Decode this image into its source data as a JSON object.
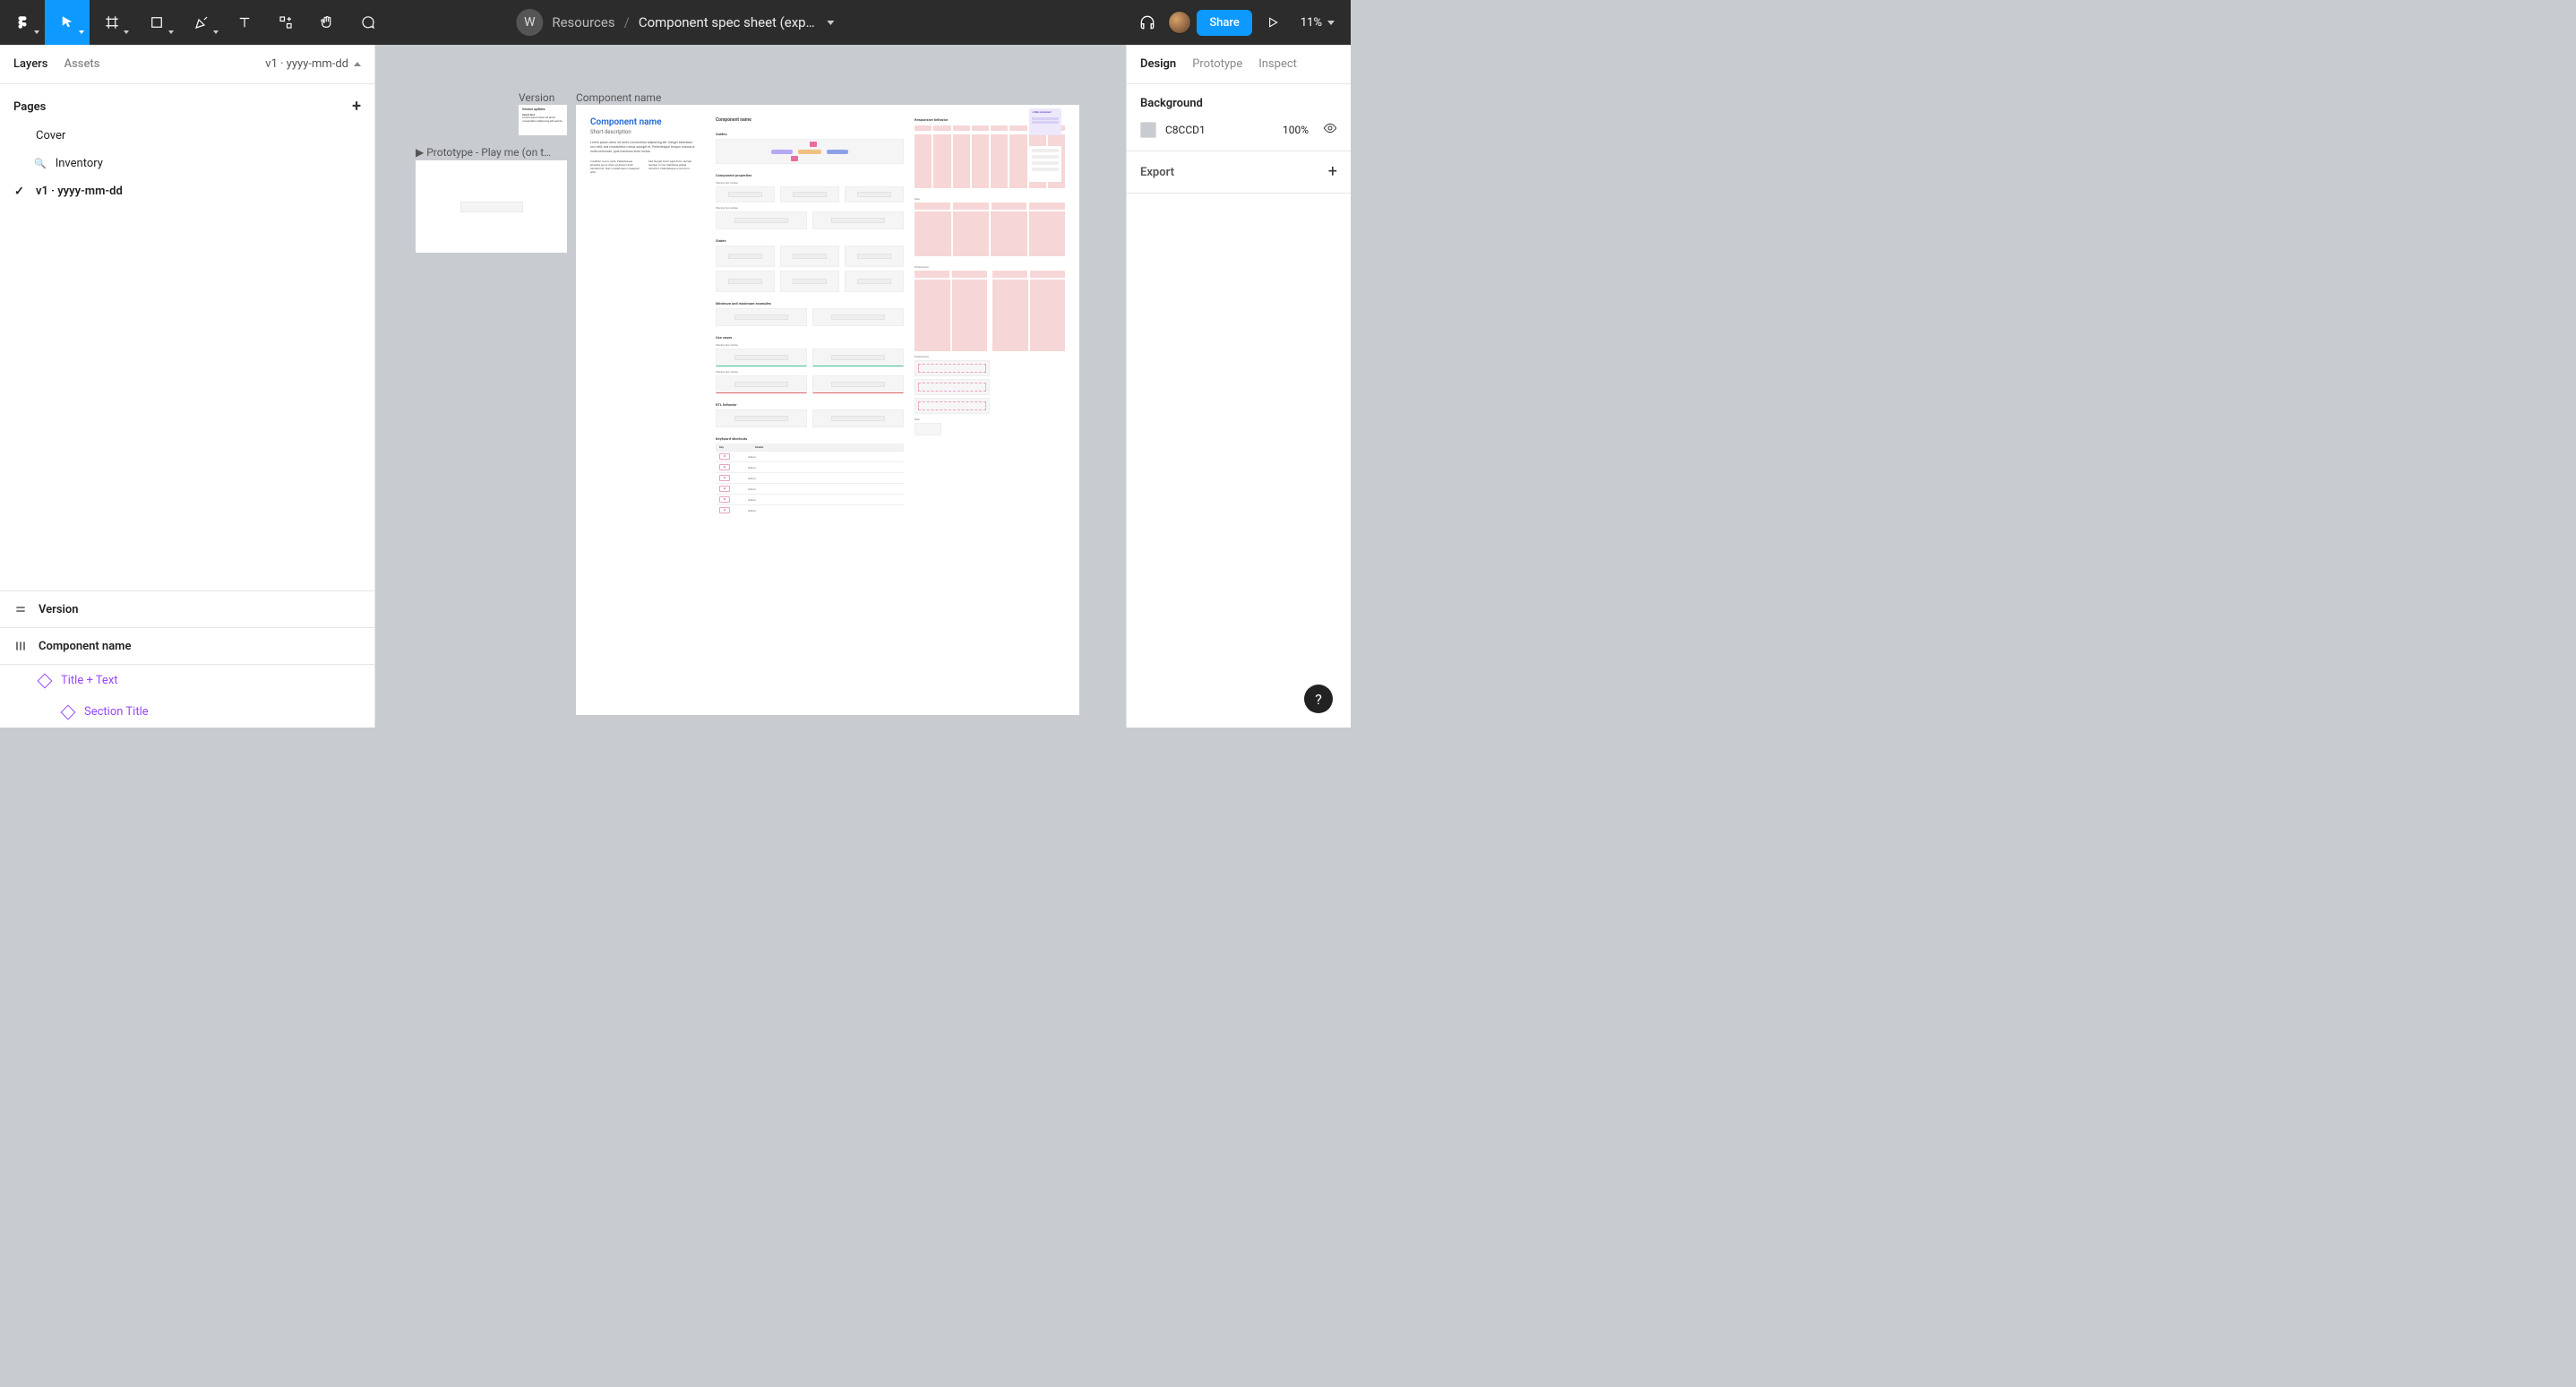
{
  "toolbar": {
    "workspace_initial": "W",
    "breadcrumb_root": "Resources",
    "file_name": "Component spec sheet (exp…",
    "share_label": "Share",
    "zoom_label": "11%"
  },
  "left_panel": {
    "tabs": {
      "layers": "Layers",
      "assets": "Assets"
    },
    "page_selector": "v1 · yyyy-mm-dd",
    "pages_header": "Pages",
    "pages": [
      {
        "label": "Cover"
      },
      {
        "label": "Inventory",
        "icon": "search"
      },
      {
        "label": "v1  ·  yyyy-mm-dd",
        "active": true
      }
    ],
    "layers": {
      "frame_version": "Version",
      "frame_component": "Component name",
      "child_title_text": "Title + Text",
      "child_section_title": "Section Title"
    }
  },
  "right_panel": {
    "tabs": {
      "design": "Design",
      "prototype": "Prototype",
      "inspect": "Inspect"
    },
    "background_label": "Background",
    "background_hex": "C8CCD1",
    "background_opacity": "100%",
    "export_label": "Export"
  },
  "canvas": {
    "version_label": "Version",
    "component_label": "Component name",
    "prototype_label": "▶ Prototype - Play me (on t…",
    "version_card": {
      "title": "Version updates",
      "section": "Insert text",
      "body": "Lorem ipsum dolor sit amet consectetur adipiscing elit sed do."
    },
    "spec": {
      "title": "Component name",
      "subtitle": "Short description",
      "lorem1": "Lorem ipsum dolor sit amet, consectetur adipiscing elit. Integer bibendum orci velit, sed consectetur metus suscipit et. Pellentesque tempor massa ut nulla commodo, quis maximus enim luctus.",
      "lorem2a": "Curabitur a arcu nulla. Pellentesque pharetra purus dolor, et dictum enim hendrerit et. Nunc scelerisque consequat ante.",
      "lorem2b": "Sed feugiat tortor eget dolor semper semper. In hac habitasse platea dictumst. Pellentesque a nisl et mi.",
      "header2": "Component name",
      "sec_guides": "Guides",
      "sec_properties": "Component properties",
      "prop_row_label": "Placing 2px stroke",
      "sec_states": "States",
      "sec_minmax": "Minimum and maximum examples",
      "sec_usecases": "Use cases",
      "sec_rtl": "RTL behavior",
      "sec_keyboard": "Keyboard shortcuts",
      "ks_h1": "Key",
      "ks_h2": "Details",
      "ks_action": "Action",
      "sec_responsive": "Responsive behavior",
      "resp_size": "Size",
      "resp_dimensions": "Dimensions",
      "resp_size2": "Size"
    },
    "side_card": {
      "title": "✦ Main component"
    }
  },
  "help_label": "?"
}
